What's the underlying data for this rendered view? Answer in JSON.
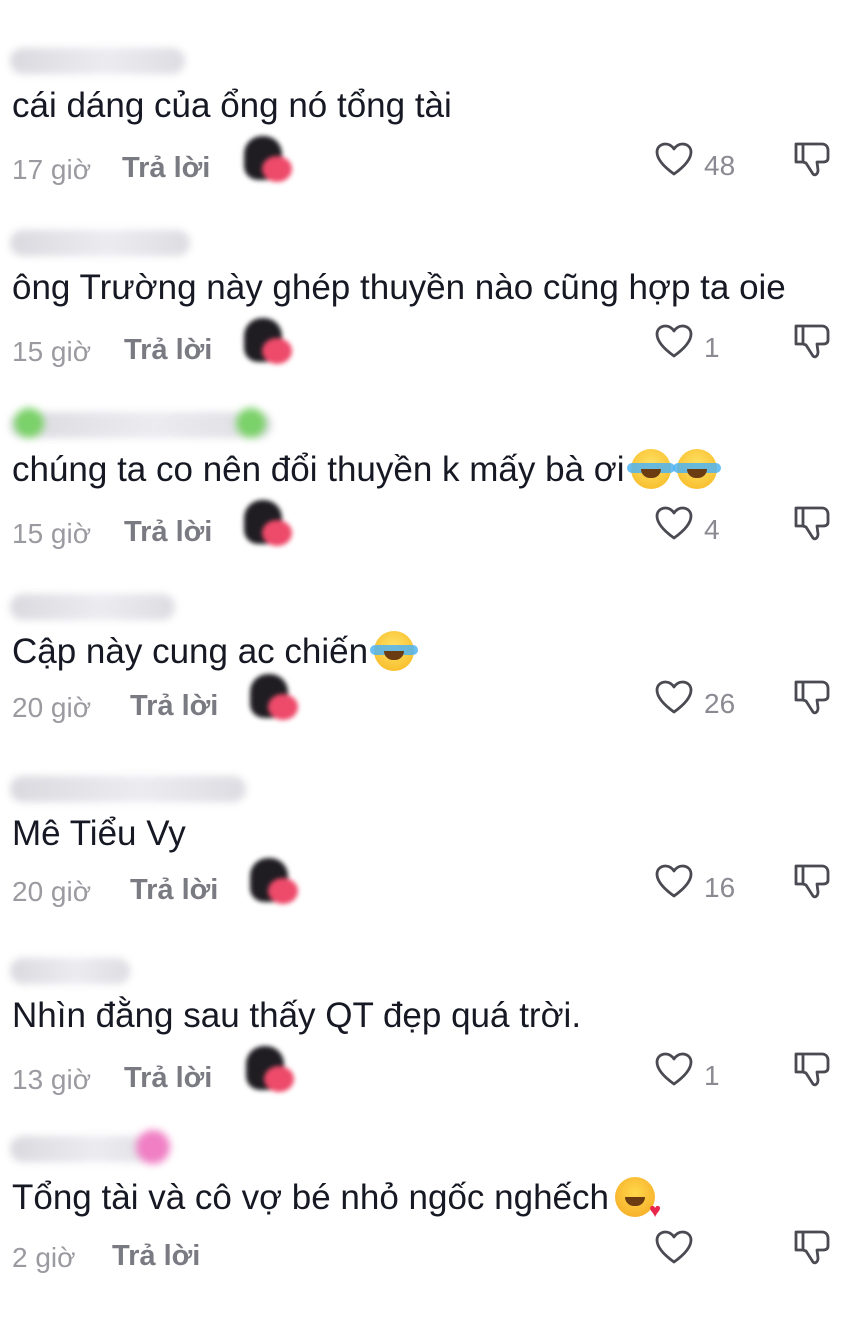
{
  "labels": {
    "reply": "Trả lời"
  },
  "icons": {
    "like": "heart-outline-icon",
    "dislike": "thumbs-down-outline-icon",
    "avatar": "avatar-blurred",
    "username": "username-blurred"
  },
  "colors": {
    "text": "#161823",
    "meta": "#9a9aa1",
    "reply": "#7a7a82",
    "icon": "#4a4a52",
    "background": "#ffffff"
  },
  "comments": [
    {
      "text": "cái dáng của ổng nó tổng tài",
      "time": "17 giờ",
      "likes": "48",
      "emojis": []
    },
    {
      "text": "ông Trường này ghép thuyền nào cũng hợp ta oie",
      "time": "15 giờ",
      "likes": "1",
      "emojis": []
    },
    {
      "text": "chúng ta co nên đổi thuyền k mấy bà ơi",
      "time": "15 giờ",
      "likes": "4",
      "emojis": [
        "face-with-tears-of-joy",
        "face-with-tears-of-joy"
      ]
    },
    {
      "text": "Cập này cung ac chiến",
      "time": "20 giờ",
      "likes": "26",
      "emojis": [
        "face-with-tears-of-joy"
      ]
    },
    {
      "text": "Mê Tiểu Vy",
      "time": "20 giờ",
      "likes": "16",
      "emojis": []
    },
    {
      "text": "Nhìn đằng sau thấy QT đẹp quá trời.",
      "time": "13 giờ",
      "likes": "1",
      "emojis": []
    },
    {
      "text": "Tổng tài và cô vợ bé nhỏ ngốc nghếch",
      "time": "2 giờ",
      "likes": "",
      "emojis": [
        "smiling-face-with-hearts"
      ]
    }
  ]
}
